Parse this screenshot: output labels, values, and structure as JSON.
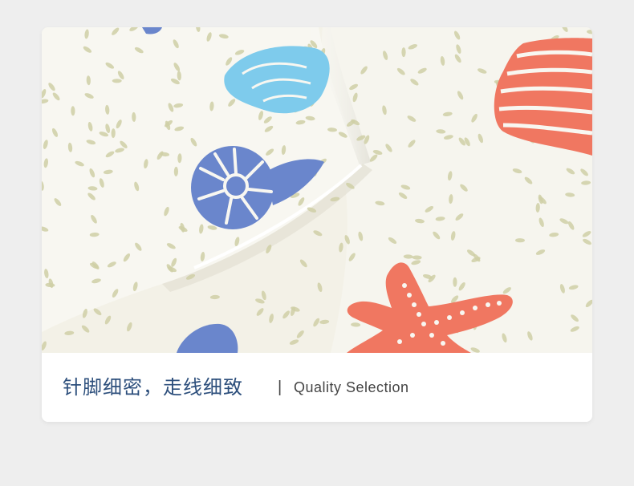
{
  "caption": {
    "title_cn": "针脚细密，走线细致",
    "separator": "|",
    "title_en": "Quality Selection"
  },
  "colors": {
    "background": "#eeeeee",
    "caption_cn": "#2d4f7c",
    "caption_en": "#444444",
    "fabric": "#f3f1e7",
    "sprinkle": "#cfcfa6",
    "coral": "#f07761",
    "light_blue": "#7ecbec",
    "periwinkle": "#6a86cc"
  }
}
